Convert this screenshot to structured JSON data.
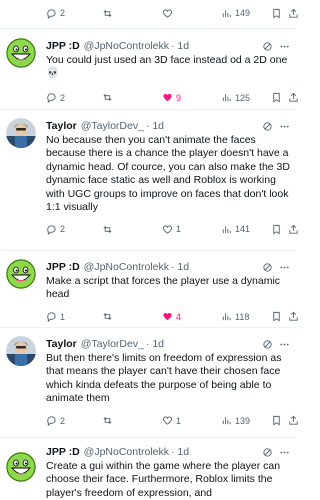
{
  "top_actions": {
    "replies": "2",
    "reposts": "",
    "likes": "",
    "views": "149"
  },
  "tweets": [
    {
      "name": "JPP :D",
      "handle": "@JpNoControlekk",
      "time": "· 1d",
      "text": "You could just used an 3D face instead od a 2D one 💀",
      "replies": "2",
      "likes": "9",
      "views": "125",
      "liked": true
    },
    {
      "name": "Taylor",
      "handle": "@TaylorDev_",
      "time": "· 1d",
      "text": "No because then you can't animate the faces because there is a chance the player doesn't have a dynamic head. Of cource, you can also make the 3D dynamic face static as well and Roblox is working with UGC groups to improve on faces that don't look 1:1 visually",
      "replies": "2",
      "likes": "1",
      "views": "141",
      "liked": false
    },
    {
      "name": "JPP :D",
      "handle": "@JpNoControlekk",
      "time": "· 1d",
      "text": "Make a script that forces the player use a dynamic head",
      "replies": "1",
      "likes": "4",
      "views": "118",
      "liked": true
    },
    {
      "name": "Taylor",
      "handle": "@TaylorDev_",
      "time": "· 1d",
      "text": "But then there's limits on freedom of expression as that means the player can't have their chosen face which kinda defeats the purpose of being able to animate them",
      "replies": "2",
      "likes": "1",
      "views": "139",
      "liked": false
    },
    {
      "name": "JPP :D",
      "handle": "@JpNoControlekk",
      "time": "· 1d",
      "text": "Create a gui within the game where the player can choose their face. Furthermore, Roblox limits the player's freedom of expression, and"
    }
  ],
  "colors": {
    "like": "#f91880",
    "muted": "#536471",
    "text": "#0f1419"
  }
}
